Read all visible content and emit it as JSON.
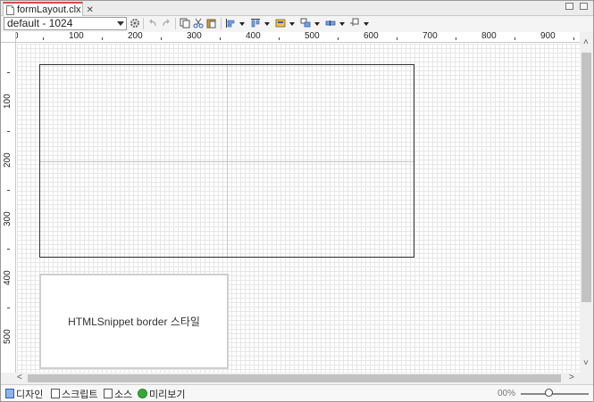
{
  "tab": {
    "title": "formLayout.clx",
    "close": "✕"
  },
  "toolbar": {
    "layout_select": "default - 1024"
  },
  "ruler": {
    "h_labels": [
      "0",
      "100",
      "200",
      "300",
      "400",
      "500",
      "600",
      "700",
      "800",
      "900"
    ],
    "v_labels": [
      "100",
      "200",
      "300",
      "400",
      "500"
    ]
  },
  "canvas": {
    "snippet_text": "HTMLSnippet border 스타일"
  },
  "bottom": {
    "tabs": [
      {
        "label": "디자인",
        "icon": "design-view-icon"
      },
      {
        "label": "스크립트",
        "icon": "script-file-icon"
      },
      {
        "label": "소스",
        "icon": "source-file-icon"
      },
      {
        "label": "미리보기",
        "icon": "preview-play-icon"
      }
    ],
    "zoom": "00%"
  },
  "scroll": {
    "left": "<",
    "right": ">",
    "up": "˄",
    "down": "˅"
  },
  "colors": {
    "tab_accent": "#d94a4a",
    "grid": "#e6e6e6",
    "preview_green": "#3aa53a"
  }
}
